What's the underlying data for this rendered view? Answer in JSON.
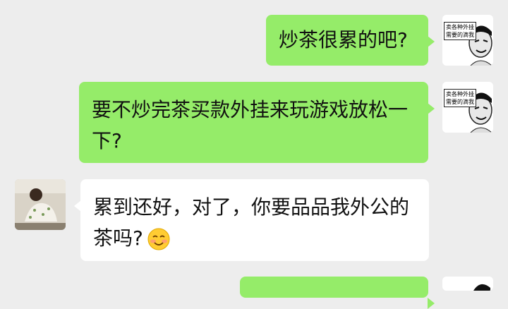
{
  "messages": [
    {
      "side": "self",
      "text": "炒茶很累的吧?",
      "meme_caption": "卖各种外挂 需要的滴我"
    },
    {
      "side": "self",
      "text": "要不炒完茶买款外挂来玩游戏放松一下?",
      "meme_caption": "卖各种外挂 需要的滴我"
    },
    {
      "side": "other",
      "text": "累到还好，对了，你要品品我外公的茶吗?",
      "emoji": "smiling-face-with-blush"
    }
  ],
  "colors": {
    "background": "#ededed",
    "self_bubble": "#95ec69",
    "other_bubble": "#ffffff"
  }
}
